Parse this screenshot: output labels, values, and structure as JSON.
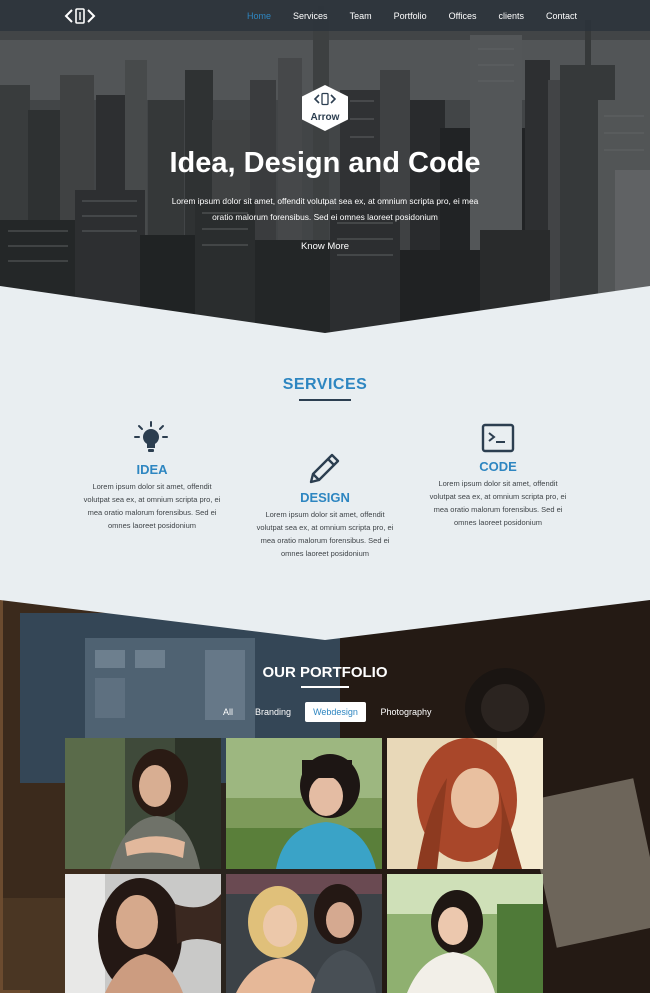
{
  "nav": {
    "links": [
      "Home",
      "Services",
      "Team",
      "Portfolio",
      "Offices",
      "clients",
      "Contact"
    ],
    "active_index": 0
  },
  "hero": {
    "badge_text": "Arrow",
    "title": "Idea, Design and Code",
    "text_line1": "Lorem ipsum dolor sit amet, offendit volutpat sea ex, at omnium scripta pro, ei mea",
    "text_line2": "oratio malorum forensibus. Sed ei omnes laoreet posidonium",
    "button": "Know More"
  },
  "services": {
    "title": "SERVICES",
    "items": [
      {
        "icon": "lightbulb-icon",
        "title": "IDEA",
        "lines": [
          "Lorem ipsum dolor sit amet, offendit",
          "volutpat sea ex, at omnium scripta pro, ei",
          "mea oratio malorum forensibus. Sed ei",
          "omnes laoreet posidonium"
        ]
      },
      {
        "icon": "pencil-icon",
        "title": "DESIGN",
        "lines": [
          "Lorem ipsum dolor sit amet, offendit",
          "volutpat sea ex, at omnium scripta pro, ei",
          "mea oratio malorum forensibus. Sed ei",
          "omnes laoreet posidonium"
        ]
      },
      {
        "icon": "terminal-icon",
        "title": "CODE",
        "lines": [
          "Lorem ipsum dolor sit amet, offendit",
          "volutpat sea ex, at omnium scripta pro, ei",
          "mea oratio malorum forensibus. Sed ei",
          "omnes laoreet posidonium"
        ]
      }
    ]
  },
  "portfolio": {
    "title": "OUR PORTFOLIO",
    "filters": [
      "All",
      "Branding",
      "Webdesign",
      "Photography"
    ],
    "active_filter": "Webdesign"
  },
  "colors": {
    "accent": "#2e86c1",
    "dark": "#2c3e50",
    "services_bg": "#e9eef1"
  }
}
